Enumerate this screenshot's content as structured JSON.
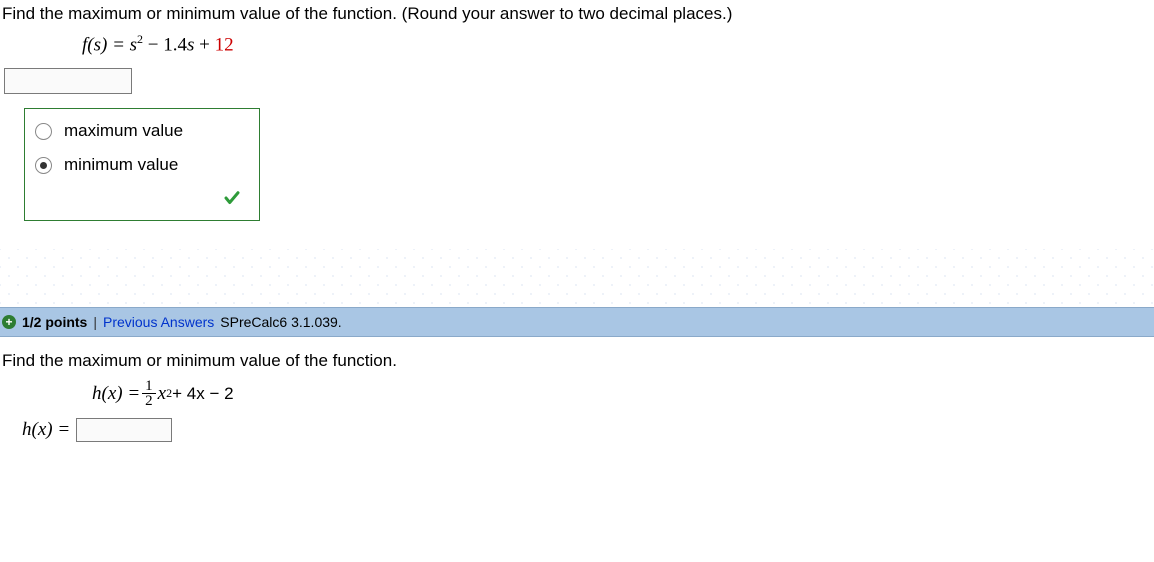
{
  "q1": {
    "prompt": "Find the maximum or minimum value of the function. (Round your answer to two decimal places.)",
    "formula_lhs": "f(s) = s",
    "formula_sup": "2",
    "formula_mid": " − ",
    "formula_coef": "1.4",
    "formula_var": "s",
    "formula_plus": " + ",
    "formula_const": "12",
    "opt_max": "maximum value",
    "opt_min": "minimum value",
    "selected": "min"
  },
  "header": {
    "points": "1/2 points",
    "prev": "Previous Answers",
    "ref": "SPreCalc6 3.1.039."
  },
  "q2": {
    "prompt": "Find the maximum or minimum value of the function.",
    "lhs": "h(x) = ",
    "frac_top": "1",
    "frac_bot": "2",
    "xvar": "x",
    "sup": "2",
    "tail": " + 4x − 2",
    "answer_label": "h(x) = "
  }
}
